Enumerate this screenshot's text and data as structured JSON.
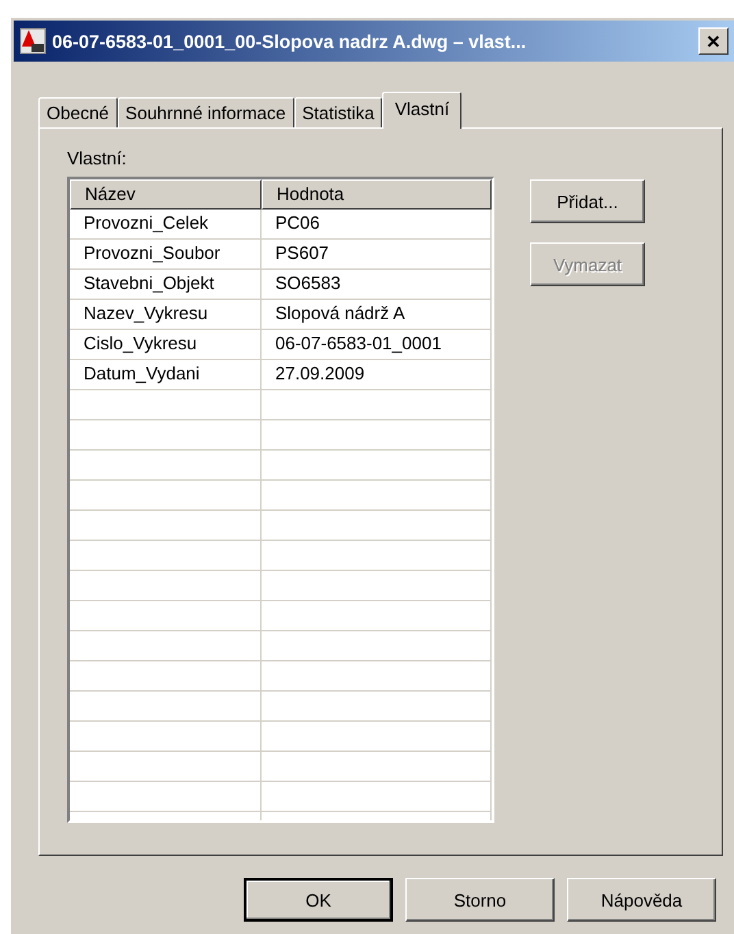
{
  "window": {
    "title": "06-07-6583-01_0001_00-Slopova nadrz A.dwg – vlast...",
    "close": "✕"
  },
  "tabs": [
    {
      "label": "Obecné",
      "selected": false
    },
    {
      "label": "Souhrnné informace",
      "selected": false
    },
    {
      "label": "Statistika",
      "selected": false
    },
    {
      "label": "Vlastní",
      "selected": true
    }
  ],
  "section_label": "Vlastní:",
  "table": {
    "columns": [
      "Název",
      "Hodnota"
    ],
    "rows": [
      [
        "Provozni_Celek",
        "PC06"
      ],
      [
        "Provozni_Soubor",
        "PS607"
      ],
      [
        "Stavebni_Objekt",
        "SO6583"
      ],
      [
        "Nazev_Vykresu",
        "Slopová nádrž A"
      ],
      [
        "Cislo_Vykresu",
        "06-07-6583-01_0001"
      ],
      [
        "Datum_Vydani",
        "27.09.2009"
      ]
    ]
  },
  "side_buttons": [
    {
      "label": "Přidat...",
      "disabled": false
    },
    {
      "label": "Vymazat",
      "disabled": true
    }
  ],
  "footer_buttons": [
    {
      "label": "OK",
      "default": true
    },
    {
      "label": "Storno",
      "default": false
    },
    {
      "label": "Nápověda",
      "default": false
    }
  ]
}
